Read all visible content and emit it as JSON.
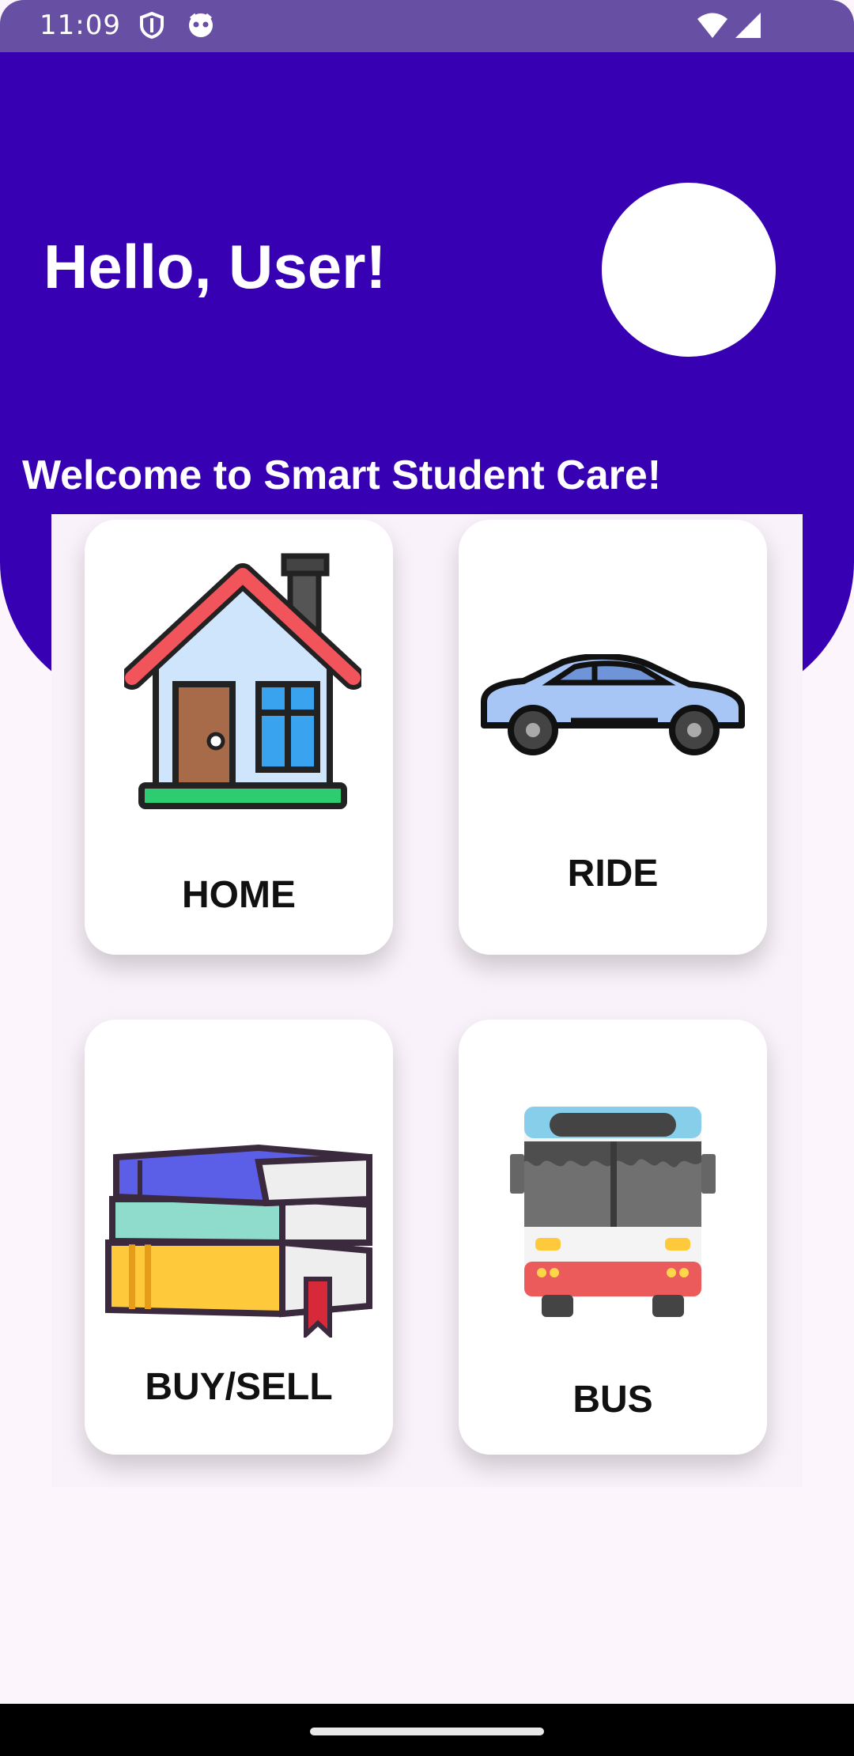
{
  "status_bar": {
    "time": "11:09",
    "icons": [
      "shield-icon",
      "notification-face-icon",
      "wifi-icon",
      "cell-signal-icon"
    ]
  },
  "header": {
    "greeting": "Hello, User!",
    "welcome": "Welcome to Smart Student Care!",
    "background_color": "#3700b3"
  },
  "cards": [
    {
      "label": "HOME",
      "icon": "house-icon"
    },
    {
      "label": "RIDE",
      "icon": "car-icon"
    },
    {
      "label": "BUY/SELL",
      "icon": "books-icon"
    },
    {
      "label": "BUS",
      "icon": "bus-icon"
    }
  ],
  "colors": {
    "status_bar": "#6750a4",
    "header": "#3700b3",
    "page_background": "#fcf5fc"
  }
}
